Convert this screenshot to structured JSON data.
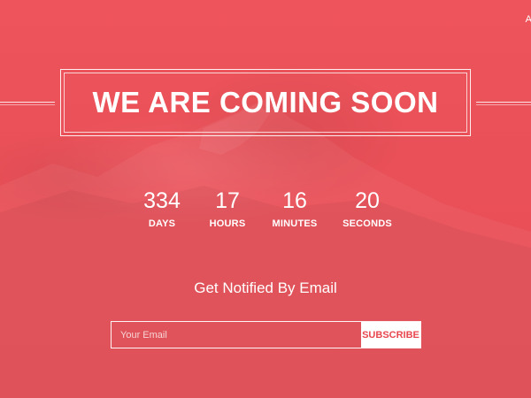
{
  "header": {
    "corner_text": "A"
  },
  "hero": {
    "title": "WE ARE COMING SOON"
  },
  "countdown": [
    {
      "value": "334",
      "label": "DAYS"
    },
    {
      "value": "17",
      "label": "HOURS"
    },
    {
      "value": "16",
      "label": "MINUTES"
    },
    {
      "value": "20",
      "label": "SECONDS"
    }
  ],
  "notify": {
    "heading": "Get Notified By Email",
    "email_placeholder": "Your Email",
    "subscribe_label": "SUBSCRIBE"
  },
  "colors": {
    "background": "#ec5259",
    "text": "#ffffff",
    "button_text": "#e8464e"
  }
}
